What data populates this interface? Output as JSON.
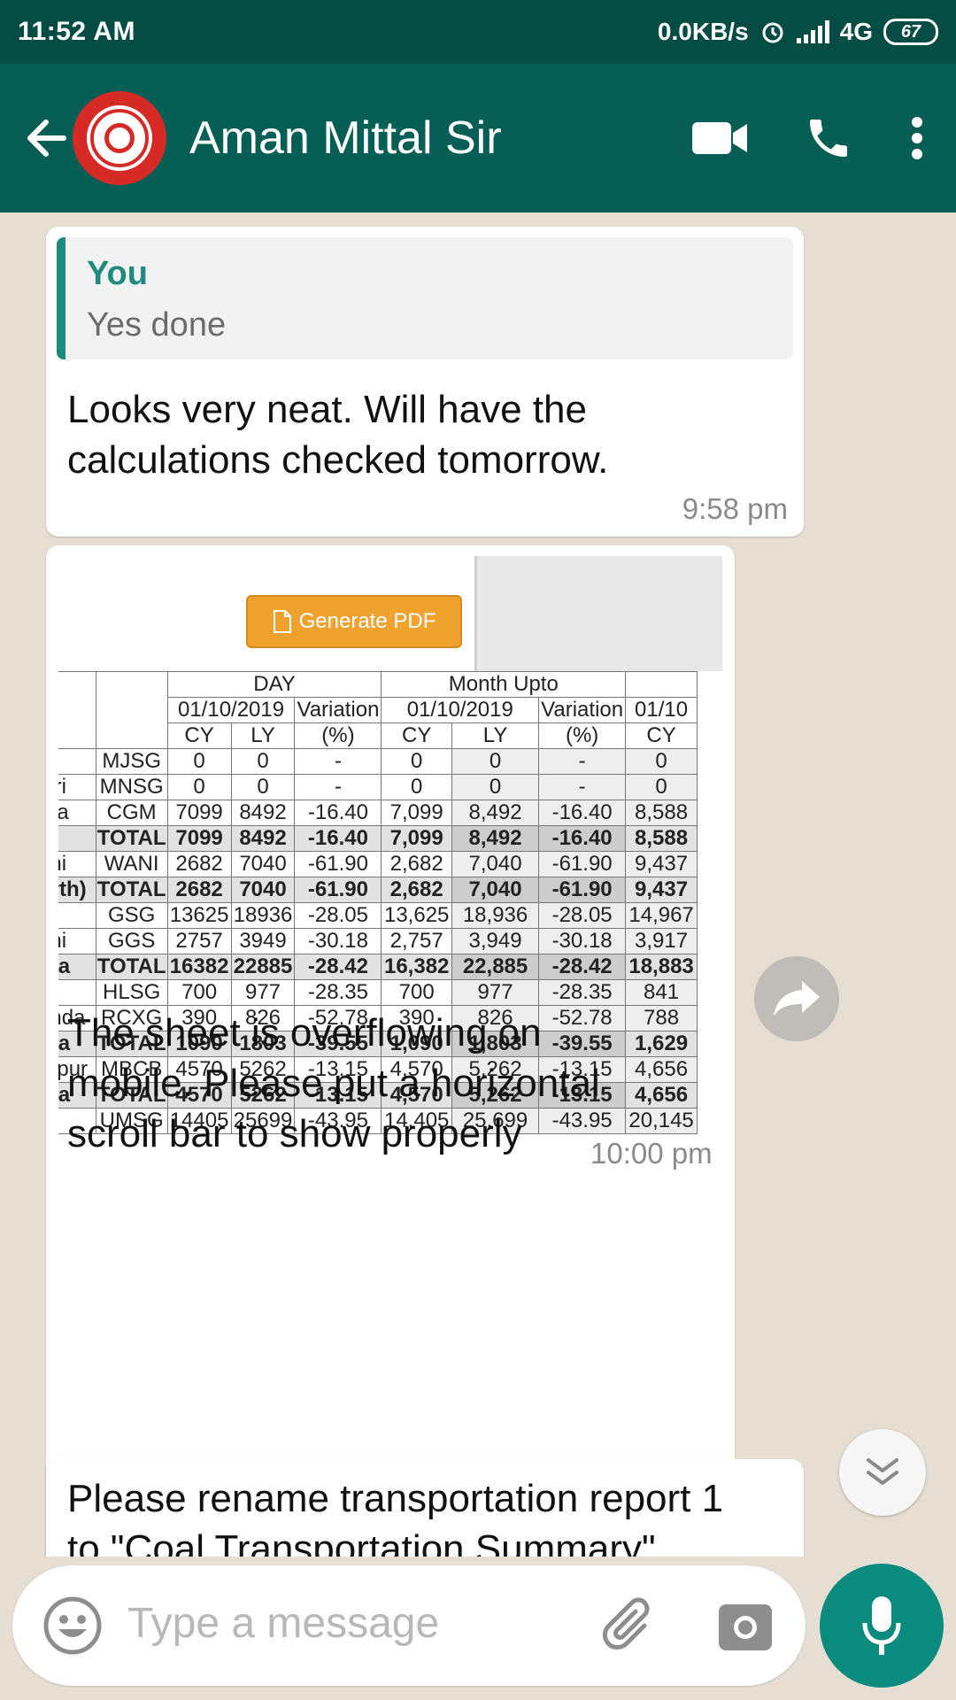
{
  "status": {
    "time": "11:52 AM",
    "net_speed": "0.0KB/s",
    "network": "4G",
    "battery": "67"
  },
  "header": {
    "contact_name": "Aman Mittal Sir",
    "icons": [
      "back-arrow-icon",
      "video-call-icon",
      "phone-icon",
      "more-vert-icon"
    ]
  },
  "messages": [
    {
      "quote_author": "You",
      "quote_text": "Yes done",
      "lines": [
        "Looks very neat. Will have the",
        "calculations checked tomorrow."
      ],
      "time": "9:58 pm"
    },
    {
      "attachment": {
        "button_label": "Generate PDF",
        "group_headers": [
          "DAY",
          "Month Upto"
        ],
        "date_headers": [
          "01/10/2019",
          "Variation",
          "01/10/2019",
          "Variation",
          "01/10"
        ],
        "sub_headers": [
          "CY",
          "LY",
          "(%)",
          "CY",
          "LY",
          "(%)",
          "CY"
        ],
        "rows": [
          [
            "",
            "MJSG",
            "0",
            "0",
            "-",
            "0",
            "0",
            "-",
            "0"
          ],
          [
            "ajri",
            "MNSG",
            "0",
            "0",
            "-",
            "0",
            "0",
            "-",
            "0"
          ],
          [
            "rea",
            "CGM",
            "7099",
            "8492",
            "-16.40",
            "7,099",
            "8,492",
            "-16.40",
            "8,588"
          ],
          [
            "",
            "TOTAL",
            "7099",
            "8492",
            "-16.40",
            "7,099",
            "8,492",
            "-16.40",
            "8,588"
          ],
          [
            "ani",
            "WANI",
            "2682",
            "7040",
            "-61.90",
            "2,682",
            "7,040",
            "-61.90",
            "9,437"
          ],
          [
            "orth)",
            "TOTAL",
            "2682",
            "7040",
            "-61.90",
            "2,682",
            "7,040",
            "-61.90",
            "9,437"
          ],
          [
            "",
            "GSG",
            "13625",
            "18936",
            "-28.05",
            "13,625",
            "18,936",
            "-28.05",
            "14,967"
          ],
          [
            "ani",
            "GGS",
            "2757",
            "3949",
            "-30.18",
            "2,757",
            "3,949",
            "-30.18",
            "3,917"
          ],
          [
            "rea",
            "TOTAL",
            "16382",
            "22885",
            "-28.42",
            "16,382",
            "22,885",
            "-28.42",
            "18,883"
          ],
          [
            "",
            "HLSG",
            "700",
            "977",
            "-28.35",
            "700",
            "977",
            "-28.35",
            "841"
          ],
          [
            "anda",
            "RCXG",
            "390",
            "826",
            "-52.78",
            "390",
            "826",
            "-52.78",
            "788"
          ],
          [
            "rea",
            "TOTAL",
            "1090",
            "1803",
            "-39.55",
            "1,090",
            "1,803",
            "-39.55",
            "1,629"
          ],
          [
            "arpur",
            "MBCB",
            "4570",
            "5262",
            "-13.15",
            "4,570",
            "5,262",
            "-13.15",
            "4,656"
          ],
          [
            "rea",
            "TOTAL",
            "4570",
            "5262",
            "-13.15",
            "4,570",
            "5,262",
            "-13.15",
            "4,656"
          ],
          [
            "",
            "UMSG",
            "14405",
            "25699",
            "-43.95",
            "14,405",
            "25,699",
            "-43.95",
            "20,145"
          ]
        ],
        "total_rows": [
          3,
          5,
          8,
          11,
          13
        ]
      },
      "lines": [
        "The sheet is overflowing on",
        "mobile. Please put a horizontal",
        "scroll bar to show properly"
      ],
      "time": "10:00 pm"
    },
    {
      "lines": [
        "Please rename transportation report 1",
        "to \"Coal Transportation Summary\""
      ]
    }
  ],
  "input": {
    "placeholder": "Type a message"
  },
  "colors": {
    "header": "#075e54",
    "statusbar": "#054d44",
    "accent": "#1f8b7c",
    "chat_bg": "#e7ded3",
    "pdf_button": "#f0a22f"
  }
}
